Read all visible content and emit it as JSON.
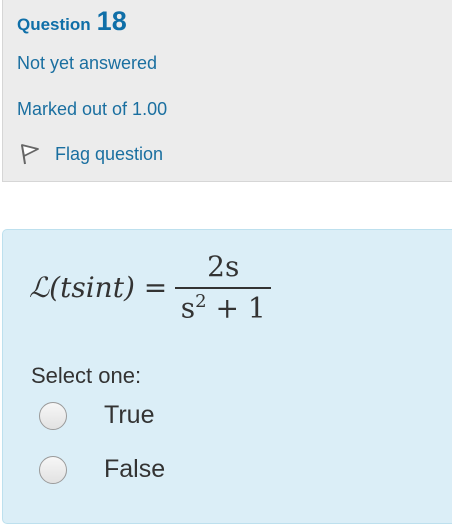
{
  "question": {
    "label": "Question",
    "number": "18",
    "state": "Not yet answered",
    "grade": "Marked out of 1.00",
    "flag_label": "Flag question",
    "flag_icon": "flag-icon"
  },
  "formula": {
    "lhs": "ℒ(tsint) =",
    "numerator": "2s",
    "denominator_base": "s",
    "denominator_exp": "2",
    "denominator_rest": " + 1"
  },
  "answer": {
    "prompt": "Select one:",
    "options": [
      {
        "label": "True"
      },
      {
        "label": "False"
      }
    ]
  },
  "colors": {
    "link": "#1a6fa0",
    "info_bg": "#ececec",
    "content_bg": "#dbeef7"
  }
}
